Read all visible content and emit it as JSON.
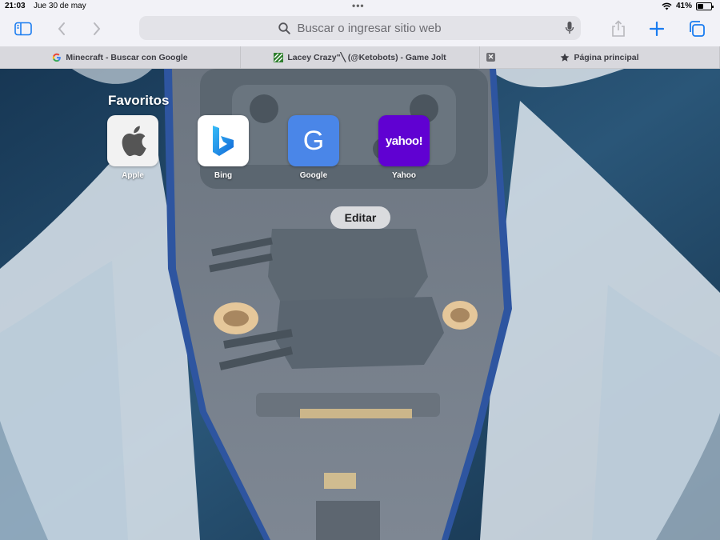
{
  "status_bar": {
    "time": "21:03",
    "date": "Jue 30 de may",
    "battery": "41%",
    "battery_level": 0.41
  },
  "toolbar": {
    "search_placeholder": "Buscar o ingresar sitio web",
    "accent_color": "#1a7cf0"
  },
  "tabs": [
    {
      "title": "Minecraft - Buscar con Google",
      "icon": "google-g-icon"
    },
    {
      "title": "Lacey Crazy\"╲ (@Ketobots) - Game Jolt",
      "icon": "gamejolt-icon"
    },
    {
      "title": "",
      "icon": "close-icon"
    },
    {
      "title": "Página principal",
      "icon": "star-icon",
      "active": true
    }
  ],
  "start_page": {
    "favorites_title": "Favoritos",
    "favorites": [
      {
        "label": "Apple",
        "icon": "apple-logo-icon",
        "color": "#f2f2f2"
      },
      {
        "label": "Bing",
        "icon": "bing-logo-icon",
        "color": "#ffffff"
      },
      {
        "label": "Google",
        "icon": "google-letter-icon",
        "color": "#4a86e8",
        "glyph": "G"
      },
      {
        "label": "Yahoo",
        "icon": "yahoo-logo-icon",
        "color": "#6001d2",
        "glyph": "yahoo!"
      }
    ],
    "edit_label": "Editar"
  }
}
